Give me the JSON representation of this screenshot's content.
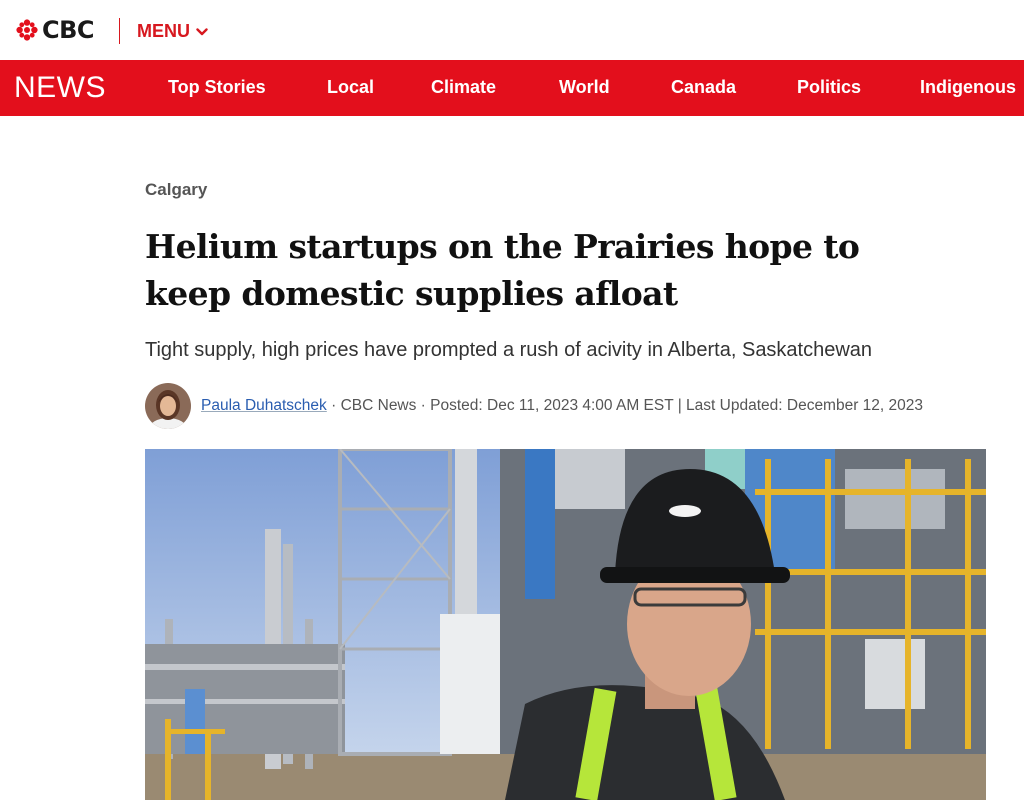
{
  "brand": {
    "name": "CBC",
    "logo_icon": "cbc-gem-icon",
    "accent": "#e30f1c"
  },
  "header": {
    "menu_label": "MENU"
  },
  "nav": {
    "section_label": "NEWS",
    "items": [
      "Top Stories",
      "Local",
      "Climate",
      "World",
      "Canada",
      "Politics",
      "Indigenous"
    ]
  },
  "article": {
    "section": "Calgary",
    "headline": "Helium startups on the Prairies hope to keep domestic supplies afloat",
    "dek": "Tight supply, high prices have prompted a rush of acivity in Alberta, Saskatchewan",
    "author": "Paula Duhatschek",
    "byline_rest": " · CBC News · Posted: Dec 11, 2023 4:00 AM EST | Last Updated: December 12, 2023"
  }
}
